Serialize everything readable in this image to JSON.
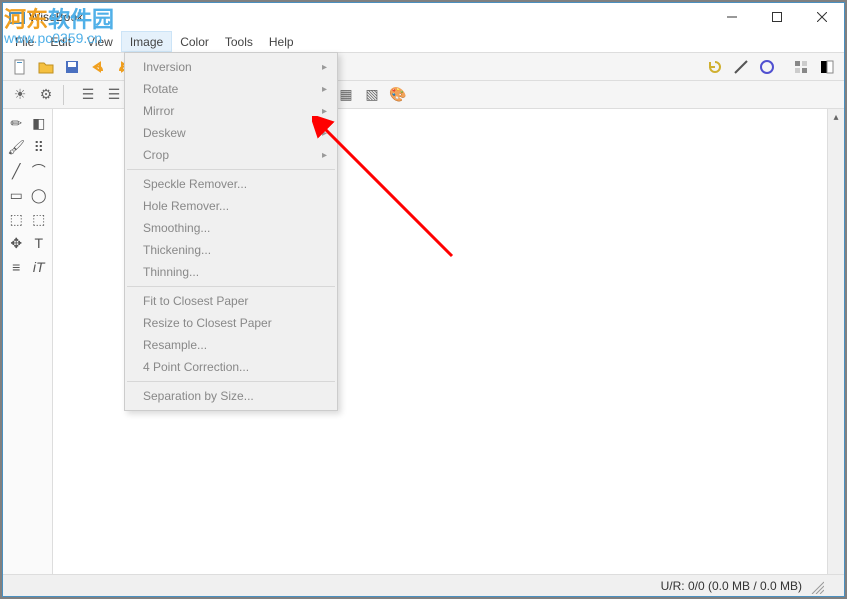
{
  "titlebar": {
    "app_name": "WiseBook"
  },
  "menubar": {
    "items": [
      "File",
      "Edit",
      "View",
      "Image",
      "Color",
      "Tools",
      "Help"
    ],
    "open_index": 3
  },
  "dropdown": {
    "groups": [
      [
        {
          "label": "Inversion",
          "submenu": true
        },
        {
          "label": "Rotate",
          "submenu": true
        },
        {
          "label": "Mirror",
          "submenu": true
        },
        {
          "label": "Deskew",
          "submenu": true
        },
        {
          "label": "Crop",
          "submenu": true
        }
      ],
      [
        {
          "label": "Speckle Remover...",
          "submenu": false
        },
        {
          "label": "Hole Remover...",
          "submenu": false
        },
        {
          "label": "Smoothing...",
          "submenu": false
        },
        {
          "label": "Thickening...",
          "submenu": false
        },
        {
          "label": "Thinning...",
          "submenu": false
        }
      ],
      [
        {
          "label": "Fit to Closest Paper",
          "submenu": false
        },
        {
          "label": "Resize to Closest Paper",
          "submenu": false
        },
        {
          "label": "Resample...",
          "submenu": false
        },
        {
          "label": "4 Point Correction...",
          "submenu": false
        }
      ],
      [
        {
          "label": "Separation by Size...",
          "submenu": false
        }
      ]
    ]
  },
  "statusbar": {
    "text": "U/R: 0/0 (0.0 MB / 0.0 MB)"
  },
  "watermark": {
    "line1a": "河东",
    "line1b": "软件园",
    "line2": "www.pc0359.cn"
  },
  "colors": {
    "arrow": "#ff0000",
    "menu_text": "#888888",
    "accent": "#50b0e8"
  }
}
